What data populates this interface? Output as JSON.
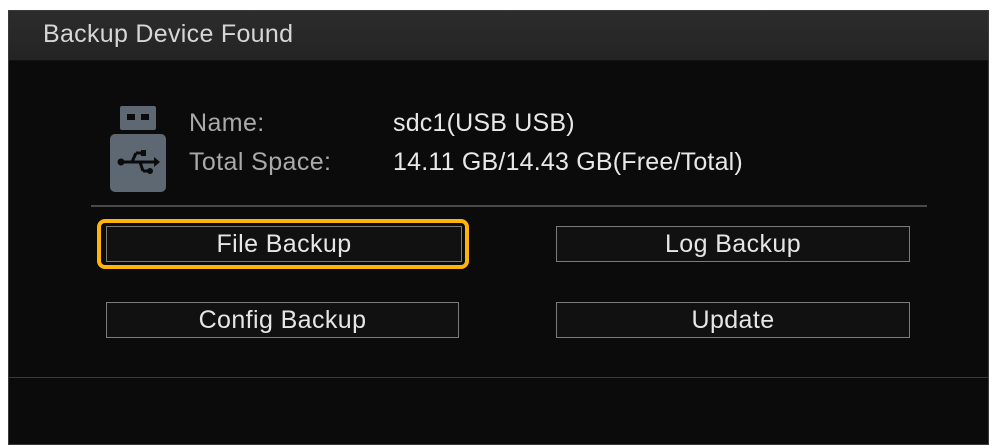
{
  "dialog": {
    "title": "Backup Device Found",
    "device_icon": "usb-drive-icon",
    "info": {
      "name_label": "Name:",
      "name_value": "sdc1(USB USB)",
      "space_label": "Total Space:",
      "space_value": "14.11 GB/14.43 GB(Free/Total)"
    },
    "buttons": {
      "file_backup": "File Backup",
      "log_backup": "Log Backup",
      "config_backup": "Config Backup",
      "update": "Update"
    },
    "selected_button": "File Backup",
    "colors": {
      "background": "#0b0b0b",
      "titlebar": "#2a2a2a",
      "highlight": "#ffb40a",
      "text": "#e6e6e6"
    }
  }
}
